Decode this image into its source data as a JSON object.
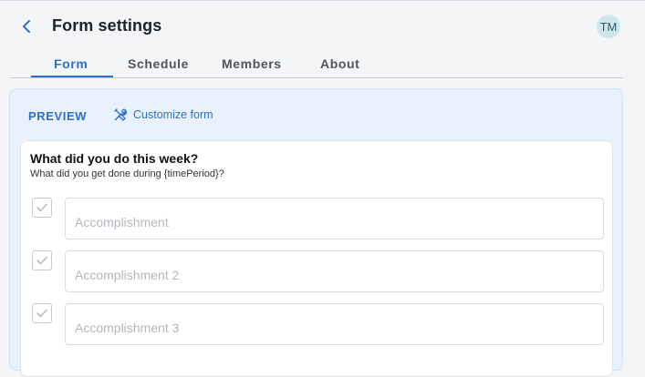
{
  "header": {
    "title": "Form settings",
    "avatar_initials": "TM",
    "back_icon": "chevron-left-icon"
  },
  "tabs": [
    {
      "label": "Form",
      "active": true
    },
    {
      "label": "Schedule",
      "active": false
    },
    {
      "label": "Members",
      "active": false
    },
    {
      "label": "About",
      "active": false
    }
  ],
  "preview": {
    "label": "PREVIEW",
    "customize_label": "Customize form",
    "customize_icon": "tools-icon"
  },
  "form": {
    "question_title": "What did you do this week?",
    "question_subtitle": "What did you get done during {timePeriod}?",
    "items": [
      {
        "placeholder": "Accomplishment",
        "value": ""
      },
      {
        "placeholder": "Accomplishment 2",
        "value": ""
      },
      {
        "placeholder": "Accomplishment 3",
        "value": ""
      }
    ]
  },
  "colors": {
    "accent": "#2f6fce",
    "preview_bg": "#e9f2fc",
    "avatar_bg": "#cfe7ec"
  }
}
